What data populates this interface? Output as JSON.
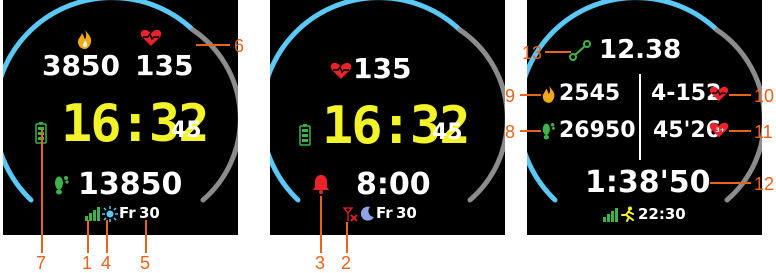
{
  "colors": {
    "background": "#000000",
    "arc_progress": "#5bc8f5",
    "arc_track": "#8c8c8c",
    "time": "#f3f329",
    "text": "#ffffff",
    "heart": "#e8232b",
    "calories": "#f2a81d",
    "steps": "#3cb44a",
    "callout": "#e8631c"
  },
  "face1": {
    "calories": "3850",
    "heart_rate": "135",
    "time": "16:32",
    "seconds": "45",
    "steps": "13850",
    "day": "Fr",
    "date": "30",
    "icons": [
      "fire-icon",
      "heart-icon",
      "battery-icon",
      "footprint-icon",
      "signal-bars-icon",
      "sun-icon"
    ]
  },
  "face2": {
    "heart_rate": "135",
    "time": "16:32",
    "seconds": "45",
    "alarm_time": "8:00",
    "day": "Fr",
    "date": "30",
    "icons": [
      "heart-icon",
      "battery-icon",
      "alarm-bell-icon",
      "no-signal-icon",
      "moon-icon"
    ]
  },
  "face3": {
    "distance": "12.38",
    "calories": "2545",
    "steps": "26950",
    "heart_zone": "4-152",
    "recovery": "45'26",
    "duration": "1:38'50",
    "clock": "22:30",
    "icons": [
      "route-icon",
      "fire-icon",
      "footprint-icon",
      "heart-icon",
      "heart-plus-icon",
      "signal-bars-icon",
      "runner-icon"
    ]
  },
  "callouts": [
    "1",
    "2",
    "3",
    "4",
    "5",
    "6",
    "7",
    "8",
    "9",
    "10",
    "11",
    "12",
    "13"
  ]
}
